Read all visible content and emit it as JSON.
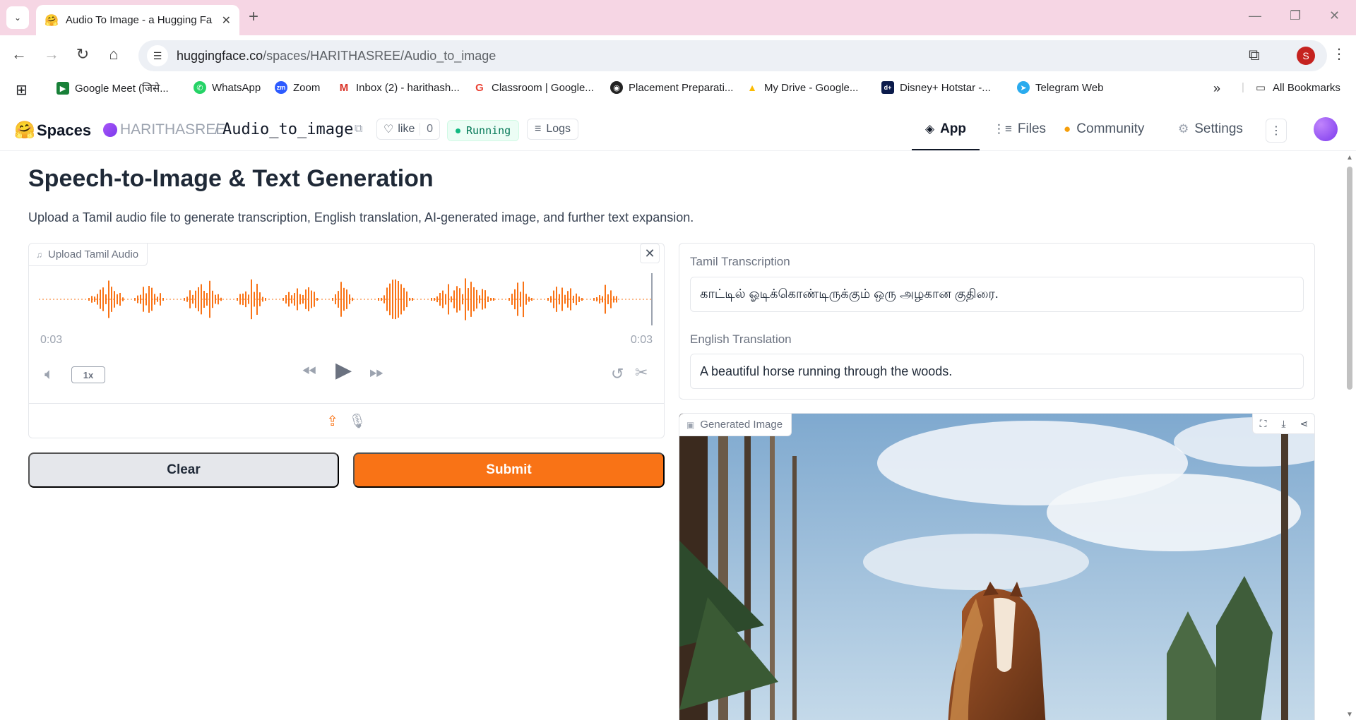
{
  "browser": {
    "tab_title": "Audio To Image - a Hugging Fa",
    "tab_favicon": "🤗",
    "url_host": "huggingface.co",
    "url_path": "/spaces/HARITHASREE/Audio_to_image",
    "profile_initial": "S",
    "bookmarks": [
      {
        "label": "Google Meet (जिसे...",
        "color": "#188038",
        "glyph": "▶"
      },
      {
        "label": "WhatsApp",
        "color": "#25d366",
        "glyph": "✆"
      },
      {
        "label": "Zoom",
        "color": "#2d5bff",
        "glyph": "zm"
      },
      {
        "label": "Inbox (2) - harithash...",
        "color": "#d93025",
        "glyph": "M"
      },
      {
        "label": "Classroom | Google...",
        "color": "#ea4335",
        "glyph": "G"
      },
      {
        "label": "Placement Preparati...",
        "color": "#222222",
        "glyph": "◉"
      },
      {
        "label": "My Drive - Google...",
        "color": "#fbbc04",
        "glyph": "▲"
      },
      {
        "label": "Disney+ Hotstar -...",
        "color": "#0b1b4b",
        "glyph": "d+"
      },
      {
        "label": "Telegram Web",
        "color": "#2aabee",
        "glyph": "➤"
      }
    ],
    "all_bookmarks": "All Bookmarks"
  },
  "hf": {
    "spaces_label": "Spaces",
    "owner": "HARITHASREE",
    "separator": "/",
    "repo": "Audio_to_image",
    "like_label": "like",
    "like_count": "0",
    "status": "Running",
    "logs_label": "Logs",
    "nav": {
      "app": "App",
      "files": "Files",
      "community": "Community",
      "settings": "Settings"
    }
  },
  "app": {
    "title": "Speech-to-Image & Text Generation",
    "description": "Upload a Tamil audio file to generate transcription, English translation, AI-generated image, and further text expansion.",
    "audio": {
      "label": "Upload Tamil Audio",
      "time_current": "0:03",
      "time_total": "0:03",
      "speed": "1x"
    },
    "clear_label": "Clear",
    "submit_label": "Submit",
    "tamil_label": "Tamil Transcription",
    "tamil_value": "காட்டில் ஓடிக்கொண்டிருக்கும் ஒரு அழகான குதிரை.",
    "english_label": "English Translation",
    "english_value": "A beautiful horse running through the woods.",
    "image_label": "Generated Image"
  },
  "colors": {
    "accent": "#f97316",
    "tab_strip": "#f6d6e4",
    "running": "#10b981"
  }
}
